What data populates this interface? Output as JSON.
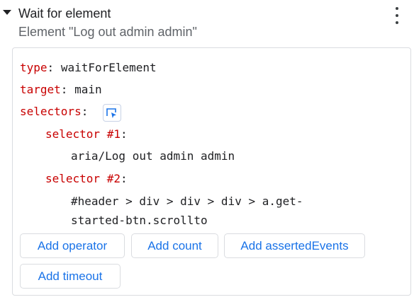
{
  "step": {
    "title": "Wait for element",
    "subtitle": "Element \"Log out admin admin\""
  },
  "fields": {
    "type": {
      "key": "type",
      "sep": ":",
      "value": "waitForElement"
    },
    "target": {
      "key": "target",
      "sep": ":",
      "value": "main"
    },
    "selectors": {
      "key": "selectors",
      "sep": ":"
    },
    "selector_1": {
      "key": "selector #1",
      "sep": ":",
      "value": "aria/Log out admin admin"
    },
    "selector_2": {
      "key": "selector #2",
      "sep": ":",
      "value_line1": "#header > div > div > div > a.get-",
      "value_line2": "started-btn.scrollto"
    }
  },
  "buttons": {
    "add_operator": "Add operator",
    "add_count": "Add count",
    "add_asserted_events": "Add assertedEvents",
    "add_timeout": "Add timeout"
  },
  "icons": {
    "collapse": "caret-down-icon",
    "menu": "more-vertical-icon",
    "selector_picker": "select-element-icon"
  },
  "colors": {
    "key": "#c80000",
    "link": "#1a73e8",
    "border": "#dadce0",
    "subtitle": "#5f6368"
  }
}
